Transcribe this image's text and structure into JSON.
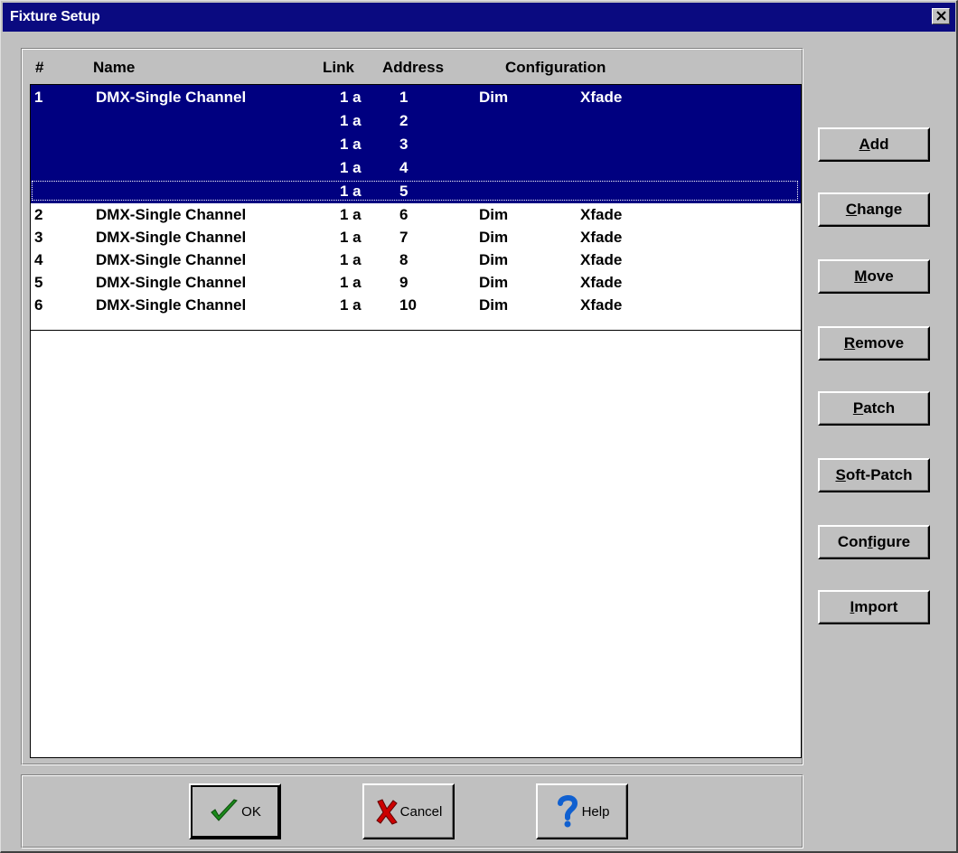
{
  "window": {
    "title": "Fixture Setup"
  },
  "list": {
    "headers": {
      "num": "#",
      "name": "Name",
      "link": "Link",
      "address": "Address",
      "configuration": "Configuration"
    },
    "rows": [
      {
        "num": "1",
        "name": "DMX-Single Channel",
        "link": "1 a",
        "address": "1",
        "type": "Dim",
        "mode": "Xfade",
        "selected": true
      },
      {
        "num": "",
        "name": "",
        "link": "1 a",
        "address": "2",
        "type": "",
        "mode": "",
        "selected": true
      },
      {
        "num": "",
        "name": "",
        "link": "1 a",
        "address": "3",
        "type": "",
        "mode": "",
        "selected": true
      },
      {
        "num": "",
        "name": "",
        "link": "1 a",
        "address": "4",
        "type": "",
        "mode": "",
        "selected": true
      },
      {
        "num": "",
        "name": "",
        "link": "1 a",
        "address": "5",
        "type": "",
        "mode": "",
        "selected": true
      },
      {
        "num": "2",
        "name": "DMX-Single Channel",
        "link": "1 a",
        "address": "6",
        "type": "Dim",
        "mode": "Xfade",
        "selected": false
      },
      {
        "num": "3",
        "name": "DMX-Single Channel",
        "link": "1 a",
        "address": "7",
        "type": "Dim",
        "mode": "Xfade",
        "selected": false
      },
      {
        "num": "4",
        "name": "DMX-Single Channel",
        "link": "1 a",
        "address": "8",
        "type": "Dim",
        "mode": "Xfade",
        "selected": false
      },
      {
        "num": "5",
        "name": "DMX-Single Channel",
        "link": "1 a",
        "address": "9",
        "type": "Dim",
        "mode": "Xfade",
        "selected": false
      },
      {
        "num": "6",
        "name": "DMX-Single Channel",
        "link": "1 a",
        "address": "10",
        "type": "Dim",
        "mode": "Xfade",
        "selected": false
      }
    ]
  },
  "side_buttons": {
    "add": {
      "pre": "",
      "key": "A",
      "post": "dd"
    },
    "change": {
      "pre": "",
      "key": "C",
      "post": "hange"
    },
    "move": {
      "pre": "",
      "key": "M",
      "post": "ove"
    },
    "remove": {
      "pre": "",
      "key": "R",
      "post": "emove"
    },
    "patch": {
      "pre": "",
      "key": "P",
      "post": "atch"
    },
    "soft_patch": {
      "pre": "",
      "key": "S",
      "post": "oft-Patch"
    },
    "configure": {
      "pre": "Con",
      "key": "f",
      "post": "igure"
    },
    "import": {
      "pre": "",
      "key": "I",
      "post": "mport"
    }
  },
  "bottom_buttons": {
    "ok": "OK",
    "cancel": "Cancel",
    "help": "Help"
  },
  "colors": {
    "title_bar": "#0a0a80",
    "selection": "#000080",
    "face": "#c0c0c0",
    "ok_check": "#1a8a1a",
    "cancel_x": "#cc0000",
    "help_q": "#1060d0"
  },
  "icons": {
    "close": "close-icon",
    "ok": "checkmark-icon",
    "cancel": "red-x-icon",
    "help": "question-mark-icon"
  }
}
